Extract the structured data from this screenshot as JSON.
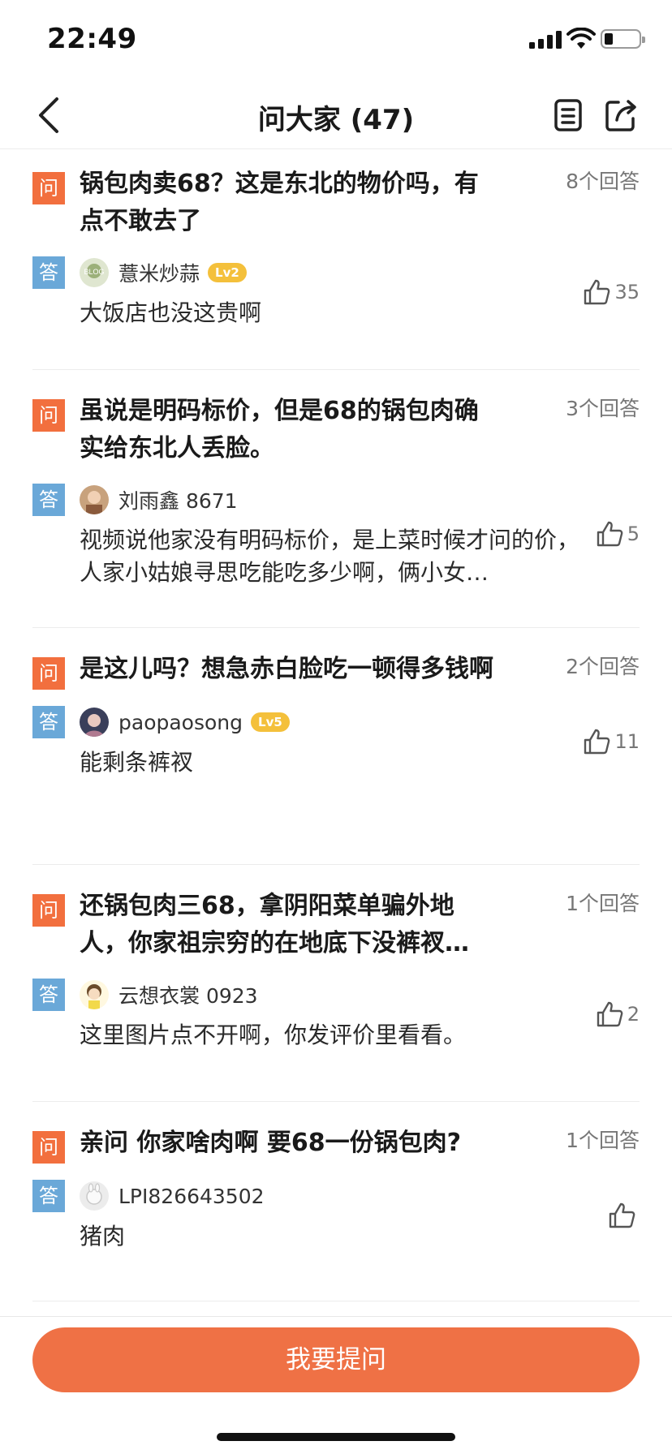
{
  "status_bar": {
    "time": "22:49"
  },
  "nav": {
    "title": "问大家 (47)"
  },
  "badges": {
    "question": "问",
    "answer": "答"
  },
  "items": [
    {
      "question": "锅包肉卖68？这是东北的物价吗，有点不敢去了",
      "answer_count": "8个回答",
      "username": "薏米炒蒜",
      "level": "Lv2",
      "answer": "大饭店也没这贵啊",
      "likes": "35"
    },
    {
      "question": "虽说是明码标价，但是68的锅包肉确实给东北人丢脸。",
      "answer_count": "3个回答",
      "username": "刘雨鑫 8671",
      "level": "",
      "answer": "视频说他家没有明码标价，是上菜时候才问的价，人家小姑娘寻思吃能吃多少啊，俩小女…",
      "likes": "5"
    },
    {
      "question": "是这儿吗？想急赤白脸吃一顿得多钱啊",
      "answer_count": "2个回答",
      "username": "paopaosong",
      "level": "Lv5",
      "answer": "能剩条裤衩",
      "likes": "11"
    },
    {
      "question": "还锅包肉三68，拿阴阳菜单骗外地人，你家祖宗穷的在地底下没裤衩…",
      "answer_count": "1个回答",
      "username": "云想衣裳 0923",
      "level": "",
      "answer": "这里图片点不开啊，你发评价里看看。",
      "likes": "2"
    },
    {
      "question": "亲问 你家啥肉啊 要68一份锅包肉?",
      "answer_count": "1个回答",
      "username": "LPI826643502",
      "level": "",
      "answer": "猪肉",
      "likes": ""
    }
  ],
  "bottom": {
    "ask_label": "我要提问"
  },
  "colors": {
    "accent": "#ef7145",
    "question_badge": "#f26f3e",
    "answer_badge": "#6aa8d8",
    "level_badge": "#f4c03b"
  },
  "icons": [
    "back-arrow-icon",
    "list-icon",
    "share-icon",
    "thumbs-up-icon"
  ]
}
